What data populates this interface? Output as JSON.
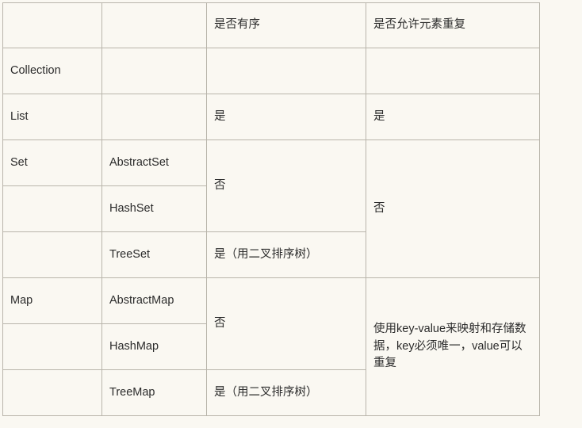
{
  "table": {
    "columns": [
      {
        "key": "interface",
        "header": ""
      },
      {
        "key": "implementation",
        "header": ""
      },
      {
        "key": "ordered",
        "header": "是否有序"
      },
      {
        "key": "duplicates",
        "header": "是否允许元素重复"
      }
    ],
    "rows": [
      {
        "interface": "Collection",
        "implementation": "",
        "ordered": "",
        "duplicates": ""
      },
      {
        "interface": "List",
        "implementation": "",
        "ordered": "是",
        "duplicates": "是"
      },
      {
        "interface": "Set",
        "implementation": "AbstractSet",
        "ordered": "否",
        "duplicates": "否"
      },
      {
        "interface": "",
        "implementation": "HashSet",
        "ordered": "",
        "duplicates": ""
      },
      {
        "interface": "",
        "implementation": "TreeSet",
        "ordered": "是（用二叉排序树）",
        "duplicates": ""
      },
      {
        "interface": "Map",
        "implementation": "AbstractMap",
        "ordered": "否",
        "duplicates": "使用key-value来映射和存储数据，key必须唯一，value可以重复"
      },
      {
        "interface": "",
        "implementation": "HashMap",
        "ordered": "",
        "duplicates": ""
      },
      {
        "interface": "",
        "implementation": "TreeMap",
        "ordered": "是（用二叉排序树）",
        "duplicates": ""
      }
    ]
  },
  "style": {
    "background": "#faf8f2",
    "border_color": "#b9b5ab",
    "text_color": "#2b2b2b"
  }
}
